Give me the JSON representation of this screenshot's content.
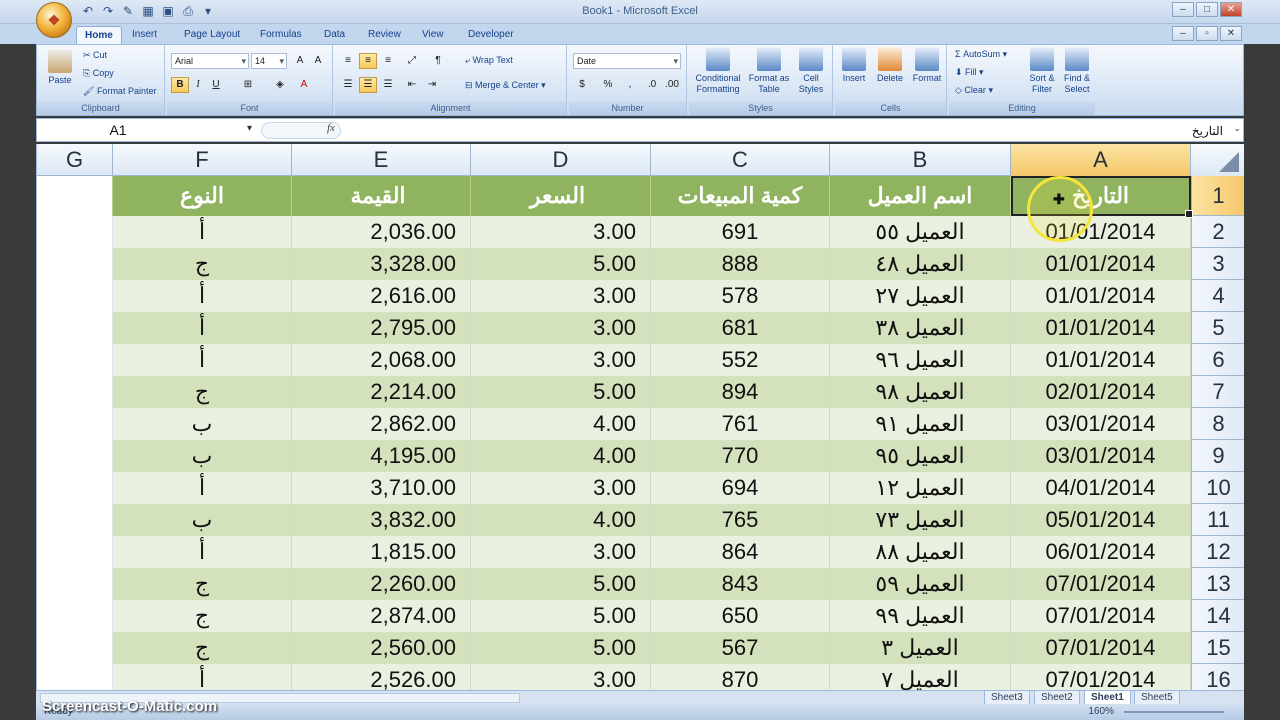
{
  "window": {
    "title": "Book1 - Microsoft Excel",
    "office_button": "⊞"
  },
  "tabs": [
    "Home",
    "Insert",
    "Page Layout",
    "Formulas",
    "Data",
    "Review",
    "View",
    "Developer"
  ],
  "ribbon": {
    "clipboard": {
      "label": "Clipboard",
      "paste": "Paste",
      "cut": "Cut",
      "copy": "Copy",
      "format_painter": "Format Painter"
    },
    "font": {
      "label": "Font",
      "name": "Arial",
      "size": "14",
      "bold": "B",
      "italic": "I",
      "underline": "U"
    },
    "alignment": {
      "label": "Alignment",
      "wrap": "Wrap Text",
      "merge": "Merge & Center"
    },
    "number": {
      "label": "Number",
      "format": "Date",
      "percent": "%"
    },
    "styles": {
      "label": "Styles",
      "conditional": "Conditional Formatting",
      "format_table": "Format as Table",
      "cell_styles": "Cell Styles"
    },
    "cells": {
      "label": "Cells",
      "insert": "Insert",
      "delete": "Delete",
      "format": "Format"
    },
    "editing": {
      "label": "Editing",
      "autosum": "AutoSum",
      "fill": "Fill",
      "clear": "Clear",
      "sort": "Sort & Filter",
      "find": "Find & Select"
    }
  },
  "formula_bar": {
    "name_box": "A1",
    "fx": "fx",
    "content": "التاريخ"
  },
  "columns": [
    "G",
    "F",
    "E",
    "D",
    "C",
    "B",
    "A"
  ],
  "header_row": {
    "row": "1",
    "type": "النوع",
    "value": "القيمة",
    "price": "السعر",
    "qty": "كمية المبيعات",
    "client": "اسم العميل",
    "date": "التاريخ"
  },
  "rows": [
    {
      "row": "2",
      "type": "أ",
      "value": "2,036.00",
      "price": "3.00",
      "qty": "691",
      "client": "العميل ٥٥",
      "date": "01/01/2014"
    },
    {
      "row": "3",
      "type": "ج",
      "value": "3,328.00",
      "price": "5.00",
      "qty": "888",
      "client": "العميل ٤٨",
      "date": "01/01/2014"
    },
    {
      "row": "4",
      "type": "أ",
      "value": "2,616.00",
      "price": "3.00",
      "qty": "578",
      "client": "العميل ٢٧",
      "date": "01/01/2014"
    },
    {
      "row": "5",
      "type": "أ",
      "value": "2,795.00",
      "price": "3.00",
      "qty": "681",
      "client": "العميل ٣٨",
      "date": "01/01/2014"
    },
    {
      "row": "6",
      "type": "أ",
      "value": "2,068.00",
      "price": "3.00",
      "qty": "552",
      "client": "العميل ٩٦",
      "date": "01/01/2014"
    },
    {
      "row": "7",
      "type": "ج",
      "value": "2,214.00",
      "price": "5.00",
      "qty": "894",
      "client": "العميل ٩٨",
      "date": "02/01/2014"
    },
    {
      "row": "8",
      "type": "ب",
      "value": "2,862.00",
      "price": "4.00",
      "qty": "761",
      "client": "العميل ٩١",
      "date": "03/01/2014"
    },
    {
      "row": "9",
      "type": "ب",
      "value": "4,195.00",
      "price": "4.00",
      "qty": "770",
      "client": "العميل ٩٥",
      "date": "03/01/2014"
    },
    {
      "row": "10",
      "type": "أ",
      "value": "3,710.00",
      "price": "3.00",
      "qty": "694",
      "client": "العميل ١٢",
      "date": "04/01/2014"
    },
    {
      "row": "11",
      "type": "ب",
      "value": "3,832.00",
      "price": "4.00",
      "qty": "765",
      "client": "العميل ٧٣",
      "date": "05/01/2014"
    },
    {
      "row": "12",
      "type": "أ",
      "value": "1,815.00",
      "price": "3.00",
      "qty": "864",
      "client": "العميل ٨٨",
      "date": "06/01/2014"
    },
    {
      "row": "13",
      "type": "ج",
      "value": "2,260.00",
      "price": "5.00",
      "qty": "843",
      "client": "العميل ٥٩",
      "date": "07/01/2014"
    },
    {
      "row": "14",
      "type": "ج",
      "value": "2,874.00",
      "price": "5.00",
      "qty": "650",
      "client": "العميل ٩٩",
      "date": "07/01/2014"
    },
    {
      "row": "15",
      "type": "ج",
      "value": "2,560.00",
      "price": "5.00",
      "qty": "567",
      "client": "العميل ٣",
      "date": "07/01/2014"
    },
    {
      "row": "16",
      "type": "أ",
      "value": "2,526.00",
      "price": "3.00",
      "qty": "870",
      "client": "العميل ٧",
      "date": "07/01/2014"
    }
  ],
  "sheet_tabs": [
    "Sheet3",
    "Sheet2",
    "Sheet1",
    "Sheet5"
  ],
  "active_sheet": "Sheet1",
  "status": {
    "ready": "Ready",
    "zoom": "160%"
  },
  "watermark": "Screencast-O-Matic.com",
  "colors": {
    "header_green": "#8fb35f",
    "band_light": "#e9f0df",
    "band_dark": "#d3e2bd",
    "selected_header": "#f6c769"
  }
}
